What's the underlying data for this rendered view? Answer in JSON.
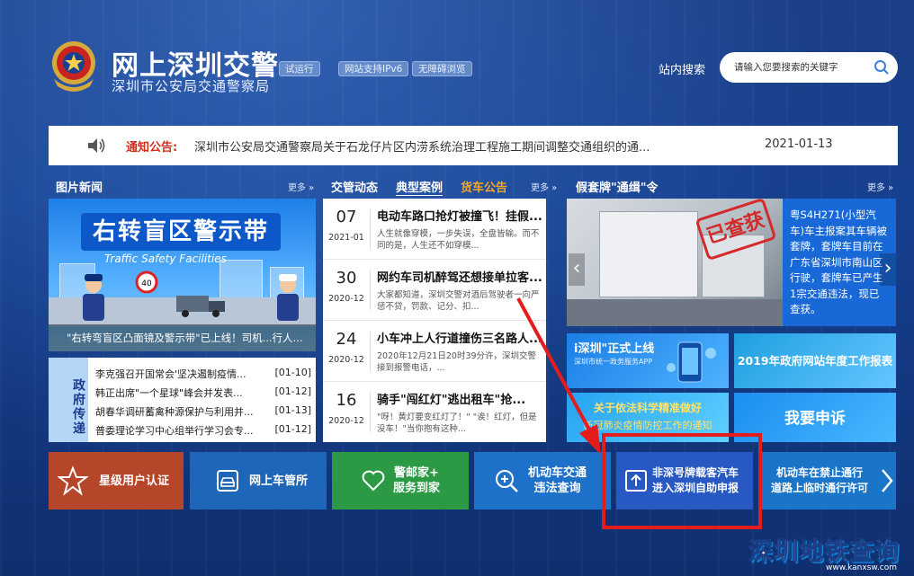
{
  "header": {
    "title": "网上深圳交警",
    "subtitle": "深圳市公安局交通警察局",
    "tags": [
      "试运行",
      "网站支持IPv6",
      "无障碍浏览"
    ],
    "search_label": "站内搜索",
    "search_placeholder": "请输入您要搜索的关键字"
  },
  "notice": {
    "label": "通知公告:",
    "text": "深圳市公安局交通警察局关于石龙仔片区内涝系统治理工程施工期间调整交通组织的通...",
    "date": "2021-01-13"
  },
  "sections": {
    "picture_news": "图片新闻",
    "more": "更多",
    "tabs": [
      "交管动态",
      "典型案例",
      "货车公告"
    ],
    "plate_title": "假套牌\"通缉\"令"
  },
  "picture_news": {
    "headline": "右转盲区警示带",
    "sub": "Traffic Safety Facilities",
    "caption": "\"右转弯盲区凸面镜及警示带\"已上线！司机...行人..."
  },
  "policy": {
    "side_label": "政府传递",
    "rows": [
      {
        "title": "李克强召开国常会'坚决遏制疫情...",
        "date": "[01-10]"
      },
      {
        "title": "韩正出席\"一个星球\"峰会并发表...",
        "date": "[01-12]"
      },
      {
        "title": "胡春华调研蓄禽种源保护与利用并...",
        "date": "[01-13]"
      },
      {
        "title": "普委理论学习中心组举行学习会专...",
        "date": "[01-12]"
      }
    ]
  },
  "news": [
    {
      "day": "07",
      "ym": "2021-01",
      "title": "电动车路口抢灯被撞飞！挂假...",
      "summary": "人生就像穿模，一步失误，全盘皆输。而不同的是，人生还不如穿模..."
    },
    {
      "day": "30",
      "ym": "2020-12",
      "title": "网约车司机醉驾还想接单拉客...",
      "summary": "大家都知道，深圳交警对酒后驾驶者一向严惩不贷，罚款、记分、扣..."
    },
    {
      "day": "24",
      "ym": "2020-12",
      "title": "小车冲上人行道撞伤三名路人...",
      "summary": "2020年12月21日20时39分许，深圳交警接到报警电话，..."
    },
    {
      "day": "16",
      "ym": "2020-12",
      "title": "骑手\"闯红灯\"逃出租车\"抢...",
      "summary": "\"呀！黄灯要变红灯了！\" \"诶！红灯，但是没车！\"当你抱有这种..."
    }
  ],
  "plate": {
    "stamp": "已查获",
    "text": "粤S4H271(小型汽车)车主报案其车辆被套牌，套牌车目前在广东省深圳市南山区行驶，套牌车已产生1宗交通违法，现已查获。"
  },
  "promos": [
    {
      "title": "i深圳\"正式上线",
      "sub": "深圳市统一政务服务APP"
    },
    {
      "title": "2019年政府网站年度工作报表"
    },
    {
      "title": "关于依法科学精准做好",
      "sub": "新冠肺炎疫情防控工作的通知"
    },
    {
      "title": "我要申诉"
    }
  ],
  "tiles": [
    {
      "label": "星级用户认证",
      "color": "#b5462a",
      "icon": "star-icon"
    },
    {
      "label": "网上车管所",
      "color": "#1e66b7",
      "icon": "car-icon"
    },
    {
      "label": "警邮家+\n服务到家",
      "color": "#2c9a44",
      "icon": "heart-icon"
    },
    {
      "label": "机动车交通\n违法查询",
      "color": "#1d71c9",
      "icon": "search-icon"
    },
    {
      "label": "非深号牌载客汽车\n进入深圳自助申报",
      "color": "#2859c2",
      "icon": "upload-icon"
    },
    {
      "label": "机动车在禁止通行\n道路上临时通行许可",
      "color": "#1a74c8",
      "icon": "chevron-right-icon"
    }
  ],
  "watermark": {
    "text": "深圳地铁查询",
    "url": "www.kanxsw.com"
  },
  "colors": {
    "accent_red": "#e51c1c",
    "notice_label": "#d0301c",
    "tab_active_orange": "#f6a623"
  }
}
